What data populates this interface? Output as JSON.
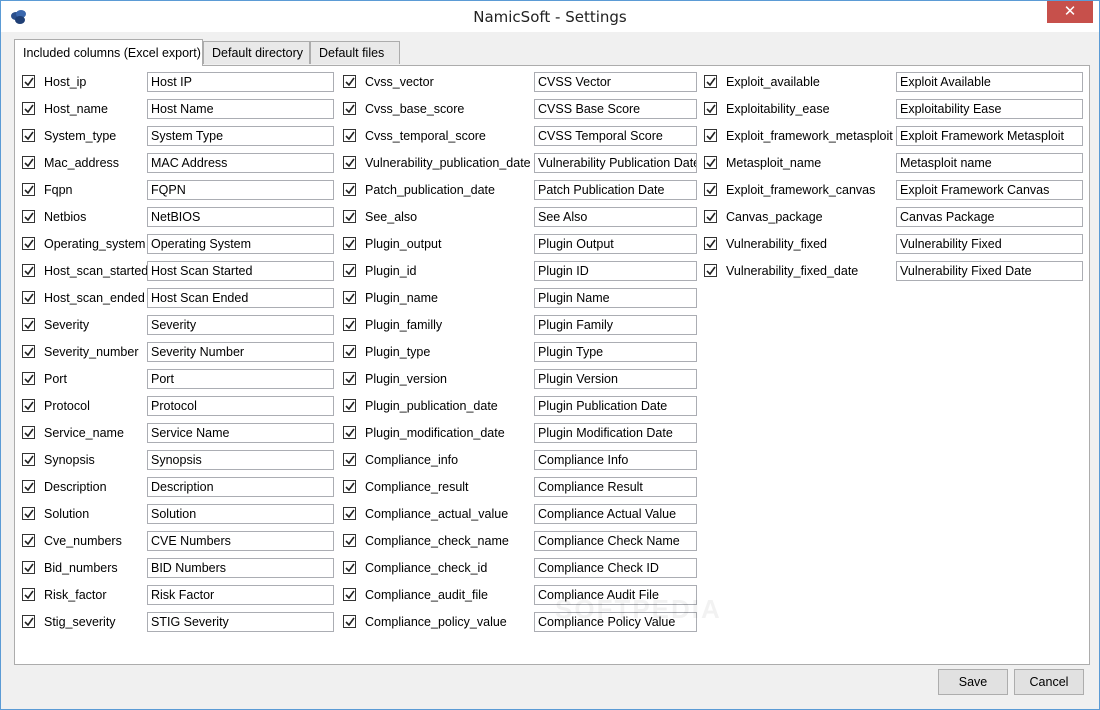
{
  "window": {
    "title": "NamicSoft - Settings",
    "close_glyph": "✕"
  },
  "tabs": [
    {
      "label": "Included columns (Excel export)",
      "active": true
    },
    {
      "label": "Default directory",
      "active": false
    },
    {
      "label": "Default files",
      "active": false
    }
  ],
  "columns": [
    [
      {
        "name": "Host_ip",
        "header": "Host IP",
        "checked": true
      },
      {
        "name": "Host_name",
        "header": "Host Name",
        "checked": true
      },
      {
        "name": "System_type",
        "header": "System Type",
        "checked": true
      },
      {
        "name": "Mac_address",
        "header": "MAC Address",
        "checked": true
      },
      {
        "name": "Fqpn",
        "header": "FQPN",
        "checked": true
      },
      {
        "name": "Netbios",
        "header": "NetBIOS",
        "checked": true
      },
      {
        "name": "Operating_system",
        "header": "Operating System",
        "checked": true
      },
      {
        "name": "Host_scan_started",
        "header": "Host Scan Started",
        "checked": true
      },
      {
        "name": "Host_scan_ended",
        "header": "Host Scan Ended",
        "checked": true
      },
      {
        "name": "Severity",
        "header": "Severity",
        "checked": true
      },
      {
        "name": "Severity_number",
        "header": "Severity Number",
        "checked": true
      },
      {
        "name": "Port",
        "header": "Port",
        "checked": true
      },
      {
        "name": "Protocol",
        "header": "Protocol",
        "checked": true
      },
      {
        "name": "Service_name",
        "header": "Service Name",
        "checked": true
      },
      {
        "name": "Synopsis",
        "header": "Synopsis",
        "checked": true
      },
      {
        "name": "Description",
        "header": "Description",
        "checked": true
      },
      {
        "name": "Solution",
        "header": "Solution",
        "checked": true
      },
      {
        "name": "Cve_numbers",
        "header": "CVE Numbers",
        "checked": true
      },
      {
        "name": "Bid_numbers",
        "header": "BID Numbers",
        "checked": true
      },
      {
        "name": "Risk_factor",
        "header": "Risk Factor",
        "checked": true
      },
      {
        "name": "Stig_severity",
        "header": "STIG Severity",
        "checked": true
      }
    ],
    [
      {
        "name": "Cvss_vector",
        "header": "CVSS Vector",
        "checked": true
      },
      {
        "name": "Cvss_base_score",
        "header": "CVSS Base Score",
        "checked": true
      },
      {
        "name": "Cvss_temporal_score",
        "header": "CVSS Temporal Score",
        "checked": true
      },
      {
        "name": "Vulnerability_publication_date",
        "header": "Vulnerability Publication Date",
        "checked": true
      },
      {
        "name": "Patch_publication_date",
        "header": "Patch Publication Date",
        "checked": true
      },
      {
        "name": "See_also",
        "header": "See Also",
        "checked": true
      },
      {
        "name": "Plugin_output",
        "header": "Plugin Output",
        "checked": true
      },
      {
        "name": "Plugin_id",
        "header": "Plugin ID",
        "checked": true
      },
      {
        "name": "Plugin_name",
        "header": "Plugin Name",
        "checked": true
      },
      {
        "name": "Plugin_familly",
        "header": "Plugin Family",
        "checked": true
      },
      {
        "name": "Plugin_type",
        "header": "Plugin Type",
        "checked": true
      },
      {
        "name": "Plugin_version",
        "header": "Plugin Version",
        "checked": true
      },
      {
        "name": "Plugin_publication_date",
        "header": "Plugin Publication Date",
        "checked": true
      },
      {
        "name": "Plugin_modification_date",
        "header": "Plugin Modification Date",
        "checked": true
      },
      {
        "name": "Compliance_info",
        "header": "Compliance Info",
        "checked": true
      },
      {
        "name": "Compliance_result",
        "header": "Compliance Result",
        "checked": true
      },
      {
        "name": "Compliance_actual_value",
        "header": "Compliance Actual Value",
        "checked": true
      },
      {
        "name": "Compliance_check_name",
        "header": "Compliance Check Name",
        "checked": true
      },
      {
        "name": "Compliance_check_id",
        "header": "Compliance Check ID",
        "checked": true
      },
      {
        "name": "Compliance_audit_file",
        "header": "Compliance Audit File",
        "checked": true
      },
      {
        "name": "Compliance_policy_value",
        "header": "Compliance Policy Value",
        "checked": true
      }
    ],
    [
      {
        "name": "Exploit_available",
        "header": "Exploit Available",
        "checked": true
      },
      {
        "name": "Exploitability_ease",
        "header": "Exploitability Ease",
        "checked": true
      },
      {
        "name": "Exploit_framework_metasploit",
        "header": "Exploit Framework Metasploit",
        "checked": true
      },
      {
        "name": "Metasploit_name",
        "header": "Metasploit name",
        "checked": true
      },
      {
        "name": "Exploit_framework_canvas",
        "header": "Exploit Framework Canvas",
        "checked": true
      },
      {
        "name": "Canvas_package",
        "header": "Canvas Package",
        "checked": true
      },
      {
        "name": "Vulnerability_fixed",
        "header": "Vulnerability Fixed",
        "checked": true
      },
      {
        "name": "Vulnerability_fixed_date",
        "header": "Vulnerability Fixed Date",
        "checked": true
      }
    ]
  ],
  "buttons": {
    "save": "Save",
    "cancel": "Cancel"
  },
  "watermark": "SOFTPEDIA",
  "colors": {
    "accent": "#5b9bd5",
    "close": "#c7504b"
  }
}
